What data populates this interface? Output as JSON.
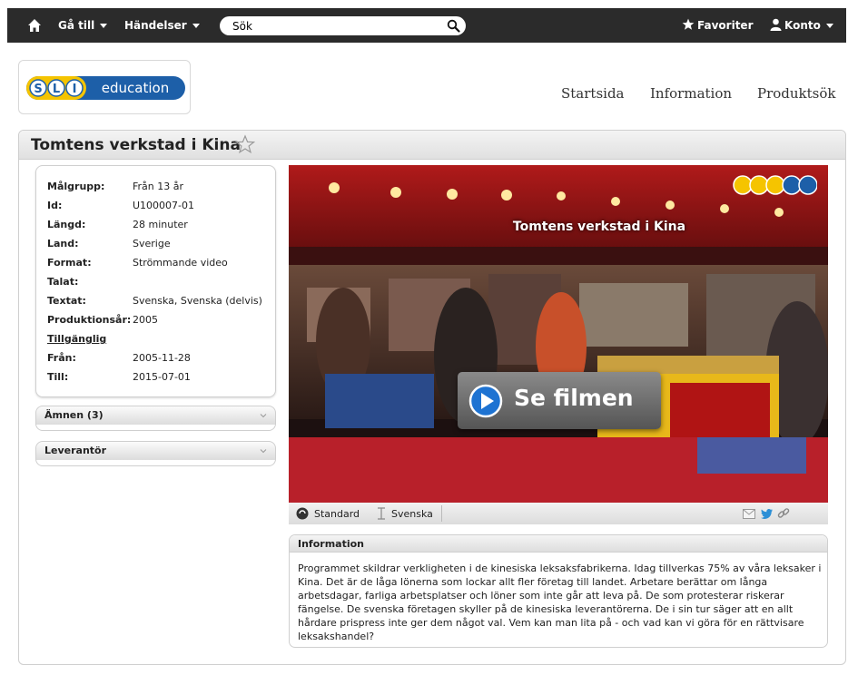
{
  "topbar": {
    "goto_label": "Gå till",
    "events_label": "Händelser",
    "search_placeholder": "Sök",
    "favorites_label": "Favoriter",
    "account_label": "Konto"
  },
  "header": {
    "logo_letters": [
      "S",
      "L",
      "I"
    ],
    "logo_word": "education",
    "nav": [
      "Startsida",
      "Information",
      "Produktsök"
    ]
  },
  "program": {
    "title": "Tomtens verkstad i Kina",
    "meta": [
      {
        "key": "Målgrupp:",
        "value": "Från 13 år"
      },
      {
        "key": "Id:",
        "value": "U100007-01"
      },
      {
        "key": "Längd:",
        "value": "28 minuter"
      },
      {
        "key": "Land:",
        "value": "Sverige"
      },
      {
        "key": "Format:",
        "value": "Strömmande video"
      },
      {
        "key": "Talat:",
        "value": ""
      },
      {
        "key": "Textat:",
        "value": "Svenska, Svenska (delvis)"
      },
      {
        "key": "Produktionsår:",
        "value": "2005"
      },
      {
        "key": "Tillgänglig",
        "value": ""
      },
      {
        "key": "Från:",
        "value": "2005-11-28"
      },
      {
        "key": "Till:",
        "value": "2015-07-01"
      }
    ],
    "accordions": [
      "Ämnen (3)",
      "Leverantör"
    ]
  },
  "video": {
    "overlay_title": "Tomtens verkstad i Kina",
    "watermark": "SLI SE",
    "play_label": "Se filmen",
    "quality_label": "Standard",
    "subtitle_label": "Svenska"
  },
  "info": {
    "heading": "Information",
    "text": "Programmet skildrar verkligheten i de kinesiska leksaksfabrikerna. Idag tillverkas 75% av våra leksaker i Kina. Det är de låga lönerna som lockar allt fler företag till landet. Arbetare berättar om långa arbetsdagar, farliga arbetsplatser och löner som inte går att leva på. De som protesterar riskerar fängelse. De svenska företagen skyller på de kinesiska leverantörerna. De i sin tur säger att en allt hårdare prispress inte ger dem något val. Vem kan man lita på - och vad kan vi göra för en rättvisare leksakshandel?"
  },
  "colors": {
    "topbar": "#2b2b2b",
    "logo_yellow": "#f5c400",
    "logo_blue": "#1d5fa8",
    "play_blue": "#1e73d2"
  }
}
